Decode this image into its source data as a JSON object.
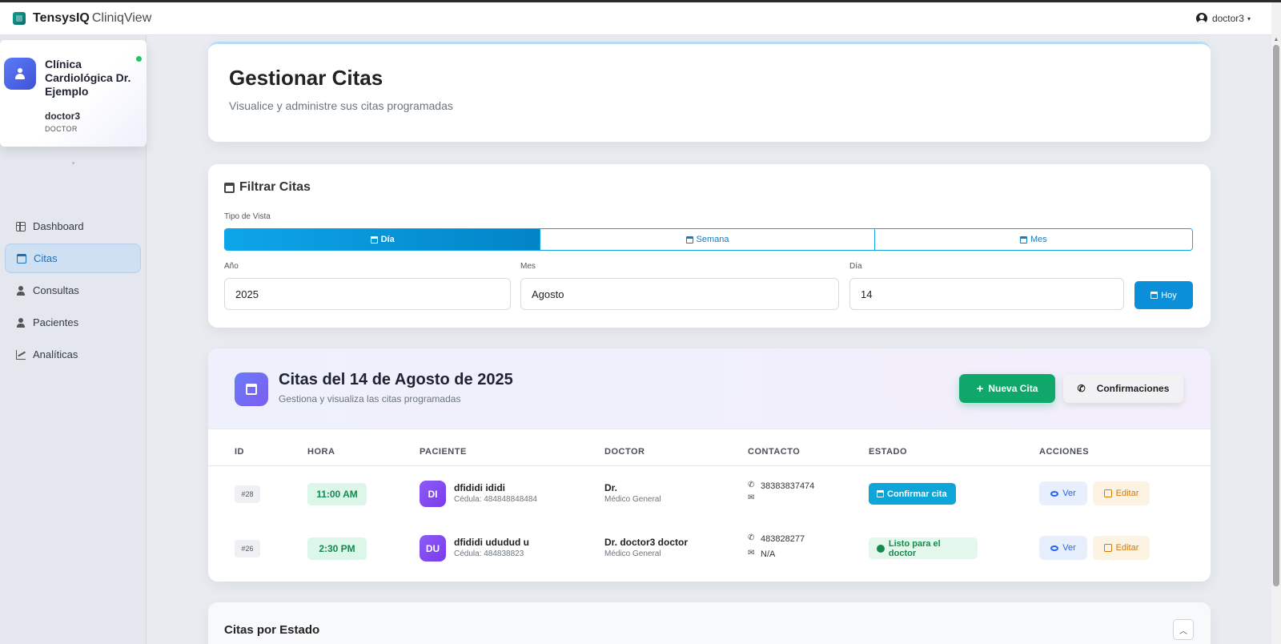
{
  "app": {
    "brand_strong": "TensysIQ",
    "brand_light": "CliniqView"
  },
  "user_menu": {
    "username": "doctor3",
    "caret": "▾"
  },
  "sidebar": {
    "clinic_name": "Clínica Cardiológica Dr. Ejemplo",
    "username": "doctor3",
    "role": "DOCTOR",
    "items": [
      {
        "label": "Dashboard",
        "icon": "grid-icon"
      },
      {
        "label": "Citas",
        "icon": "calendar-icon",
        "active": true
      },
      {
        "label": "Consultas",
        "icon": "user-doctor-icon"
      },
      {
        "label": "Pacientes",
        "icon": "user-injured-icon"
      },
      {
        "label": "Analíticas",
        "icon": "chart-line-icon"
      }
    ]
  },
  "page": {
    "title": "Gestionar Citas",
    "subtitle": "Visualice y administre sus citas programadas"
  },
  "filter": {
    "title": "Filtrar Citas",
    "view_type_label": "Tipo de Vista",
    "views": [
      "Día",
      "Semana",
      "Mes"
    ],
    "active_view": "Día",
    "year_label": "Año",
    "year_value": "2025",
    "month_label": "Mes",
    "month_value": "Agosto",
    "day_label": "Día",
    "day_value": "14",
    "today_button": "Hoy"
  },
  "appointments": {
    "title": "Citas del 14 de Agosto de 2025",
    "subtitle": "Gestiona y visualiza las citas programadas",
    "new_button": "Nueva Cita",
    "confirm_button": "Confirmaciones",
    "columns": [
      "ID",
      "HORA",
      "PACIENTE",
      "DOCTOR",
      "CONTACTO",
      "ESTADO",
      "ACCIONES"
    ],
    "rows": [
      {
        "id": "#28",
        "time": "11:00 AM",
        "initials": "DI",
        "patient": "dfididi ididi",
        "cedula": "Cédula: 484848848484",
        "doctor": "Dr.",
        "specialty": "Médico General",
        "phone": "38383837474",
        "email": "",
        "status": "Confirmar cita",
        "view": "Ver",
        "edit": "Editar"
      },
      {
        "id": "#26",
        "time": "2:30 PM",
        "initials": "DU",
        "patient": "dfididi ududud u",
        "cedula": "Cédula: 484838823",
        "doctor": "Dr. doctor3 doctor",
        "specialty": "Médico General",
        "phone": "483828277",
        "email": "N/A",
        "status": "Listo para el doctor",
        "view": "Ver",
        "edit": "Editar"
      }
    ]
  },
  "status_section": {
    "title": "Citas por Estado"
  },
  "colors": {
    "primary": "#0ea5e9",
    "success": "#0fa86a",
    "accent": "#7c3aed"
  }
}
